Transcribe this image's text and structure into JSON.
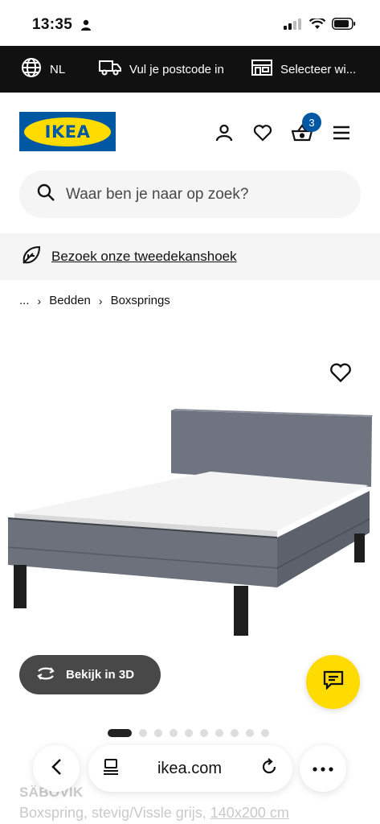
{
  "status_bar": {
    "time": "13:35"
  },
  "top_strip": {
    "language": "NL",
    "postcode": "Vul je postcode in",
    "store": "Selecteer wi..."
  },
  "header": {
    "logo": "IKEA",
    "cart_count": "3"
  },
  "search": {
    "placeholder": "Waar ben je naar op zoek?"
  },
  "promo": {
    "link": "Bezoek onze tweedekanshoek"
  },
  "breadcrumb": {
    "ellipsis": "...",
    "items": [
      "Bedden",
      "Boxsprings"
    ]
  },
  "gallery": {
    "view3d_label": "Bekijk in 3D",
    "image_count": 10,
    "active_index": 0
  },
  "product": {
    "name": "SÄBOVIK",
    "description": "Boxspring, stevig/Vissle grijs,",
    "size": "140x200 cm"
  },
  "browser": {
    "url": "ikea.com"
  },
  "colors": {
    "ikea_blue": "#0058a3",
    "ikea_yellow": "#ffdb00",
    "strip_bg": "#111111"
  },
  "icons": [
    "globe-icon",
    "truck-icon",
    "store-icon",
    "user-icon",
    "heart-icon",
    "basket-icon",
    "menu-icon",
    "search-icon",
    "leaf-icon",
    "rotate-3d-icon",
    "chat-icon",
    "back-icon",
    "tabs-icon",
    "reload-icon",
    "more-icon"
  ]
}
